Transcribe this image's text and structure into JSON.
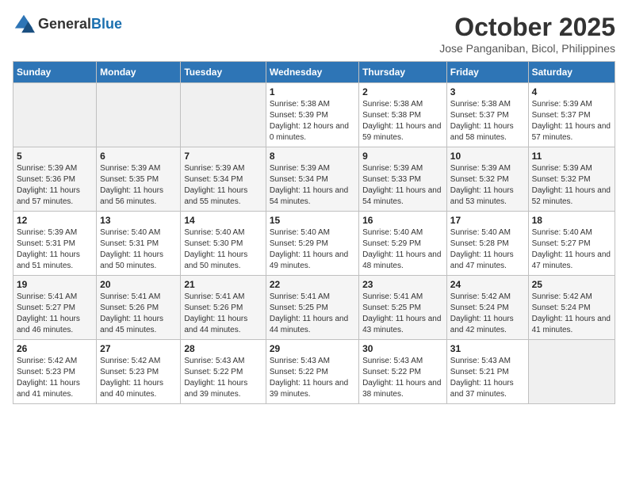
{
  "logo": {
    "general": "General",
    "blue": "Blue"
  },
  "header": {
    "month": "October 2025",
    "location": "Jose Panganiban, Bicol, Philippines"
  },
  "weekdays": [
    "Sunday",
    "Monday",
    "Tuesday",
    "Wednesday",
    "Thursday",
    "Friday",
    "Saturday"
  ],
  "weeks": [
    [
      {
        "day": "",
        "sunrise": "",
        "sunset": "",
        "daylight": "",
        "empty": true
      },
      {
        "day": "",
        "sunrise": "",
        "sunset": "",
        "daylight": "",
        "empty": true
      },
      {
        "day": "",
        "sunrise": "",
        "sunset": "",
        "daylight": "",
        "empty": true
      },
      {
        "day": "1",
        "sunrise": "Sunrise: 5:38 AM",
        "sunset": "Sunset: 5:39 PM",
        "daylight": "Daylight: 12 hours and 0 minutes."
      },
      {
        "day": "2",
        "sunrise": "Sunrise: 5:38 AM",
        "sunset": "Sunset: 5:38 PM",
        "daylight": "Daylight: 11 hours and 59 minutes."
      },
      {
        "day": "3",
        "sunrise": "Sunrise: 5:38 AM",
        "sunset": "Sunset: 5:37 PM",
        "daylight": "Daylight: 11 hours and 58 minutes."
      },
      {
        "day": "4",
        "sunrise": "Sunrise: 5:39 AM",
        "sunset": "Sunset: 5:37 PM",
        "daylight": "Daylight: 11 hours and 57 minutes."
      }
    ],
    [
      {
        "day": "5",
        "sunrise": "Sunrise: 5:39 AM",
        "sunset": "Sunset: 5:36 PM",
        "daylight": "Daylight: 11 hours and 57 minutes."
      },
      {
        "day": "6",
        "sunrise": "Sunrise: 5:39 AM",
        "sunset": "Sunset: 5:35 PM",
        "daylight": "Daylight: 11 hours and 56 minutes."
      },
      {
        "day": "7",
        "sunrise": "Sunrise: 5:39 AM",
        "sunset": "Sunset: 5:34 PM",
        "daylight": "Daylight: 11 hours and 55 minutes."
      },
      {
        "day": "8",
        "sunrise": "Sunrise: 5:39 AM",
        "sunset": "Sunset: 5:34 PM",
        "daylight": "Daylight: 11 hours and 54 minutes."
      },
      {
        "day": "9",
        "sunrise": "Sunrise: 5:39 AM",
        "sunset": "Sunset: 5:33 PM",
        "daylight": "Daylight: 11 hours and 54 minutes."
      },
      {
        "day": "10",
        "sunrise": "Sunrise: 5:39 AM",
        "sunset": "Sunset: 5:32 PM",
        "daylight": "Daylight: 11 hours and 53 minutes."
      },
      {
        "day": "11",
        "sunrise": "Sunrise: 5:39 AM",
        "sunset": "Sunset: 5:32 PM",
        "daylight": "Daylight: 11 hours and 52 minutes."
      }
    ],
    [
      {
        "day": "12",
        "sunrise": "Sunrise: 5:39 AM",
        "sunset": "Sunset: 5:31 PM",
        "daylight": "Daylight: 11 hours and 51 minutes."
      },
      {
        "day": "13",
        "sunrise": "Sunrise: 5:40 AM",
        "sunset": "Sunset: 5:31 PM",
        "daylight": "Daylight: 11 hours and 50 minutes."
      },
      {
        "day": "14",
        "sunrise": "Sunrise: 5:40 AM",
        "sunset": "Sunset: 5:30 PM",
        "daylight": "Daylight: 11 hours and 50 minutes."
      },
      {
        "day": "15",
        "sunrise": "Sunrise: 5:40 AM",
        "sunset": "Sunset: 5:29 PM",
        "daylight": "Daylight: 11 hours and 49 minutes."
      },
      {
        "day": "16",
        "sunrise": "Sunrise: 5:40 AM",
        "sunset": "Sunset: 5:29 PM",
        "daylight": "Daylight: 11 hours and 48 minutes."
      },
      {
        "day": "17",
        "sunrise": "Sunrise: 5:40 AM",
        "sunset": "Sunset: 5:28 PM",
        "daylight": "Daylight: 11 hours and 47 minutes."
      },
      {
        "day": "18",
        "sunrise": "Sunrise: 5:40 AM",
        "sunset": "Sunset: 5:27 PM",
        "daylight": "Daylight: 11 hours and 47 minutes."
      }
    ],
    [
      {
        "day": "19",
        "sunrise": "Sunrise: 5:41 AM",
        "sunset": "Sunset: 5:27 PM",
        "daylight": "Daylight: 11 hours and 46 minutes."
      },
      {
        "day": "20",
        "sunrise": "Sunrise: 5:41 AM",
        "sunset": "Sunset: 5:26 PM",
        "daylight": "Daylight: 11 hours and 45 minutes."
      },
      {
        "day": "21",
        "sunrise": "Sunrise: 5:41 AM",
        "sunset": "Sunset: 5:26 PM",
        "daylight": "Daylight: 11 hours and 44 minutes."
      },
      {
        "day": "22",
        "sunrise": "Sunrise: 5:41 AM",
        "sunset": "Sunset: 5:25 PM",
        "daylight": "Daylight: 11 hours and 44 minutes."
      },
      {
        "day": "23",
        "sunrise": "Sunrise: 5:41 AM",
        "sunset": "Sunset: 5:25 PM",
        "daylight": "Daylight: 11 hours and 43 minutes."
      },
      {
        "day": "24",
        "sunrise": "Sunrise: 5:42 AM",
        "sunset": "Sunset: 5:24 PM",
        "daylight": "Daylight: 11 hours and 42 minutes."
      },
      {
        "day": "25",
        "sunrise": "Sunrise: 5:42 AM",
        "sunset": "Sunset: 5:24 PM",
        "daylight": "Daylight: 11 hours and 41 minutes."
      }
    ],
    [
      {
        "day": "26",
        "sunrise": "Sunrise: 5:42 AM",
        "sunset": "Sunset: 5:23 PM",
        "daylight": "Daylight: 11 hours and 41 minutes."
      },
      {
        "day": "27",
        "sunrise": "Sunrise: 5:42 AM",
        "sunset": "Sunset: 5:23 PM",
        "daylight": "Daylight: 11 hours and 40 minutes."
      },
      {
        "day": "28",
        "sunrise": "Sunrise: 5:43 AM",
        "sunset": "Sunset: 5:22 PM",
        "daylight": "Daylight: 11 hours and 39 minutes."
      },
      {
        "day": "29",
        "sunrise": "Sunrise: 5:43 AM",
        "sunset": "Sunset: 5:22 PM",
        "daylight": "Daylight: 11 hours and 39 minutes."
      },
      {
        "day": "30",
        "sunrise": "Sunrise: 5:43 AM",
        "sunset": "Sunset: 5:22 PM",
        "daylight": "Daylight: 11 hours and 38 minutes."
      },
      {
        "day": "31",
        "sunrise": "Sunrise: 5:43 AM",
        "sunset": "Sunset: 5:21 PM",
        "daylight": "Daylight: 11 hours and 37 minutes."
      },
      {
        "day": "",
        "sunrise": "",
        "sunset": "",
        "daylight": "",
        "empty": true
      }
    ]
  ]
}
